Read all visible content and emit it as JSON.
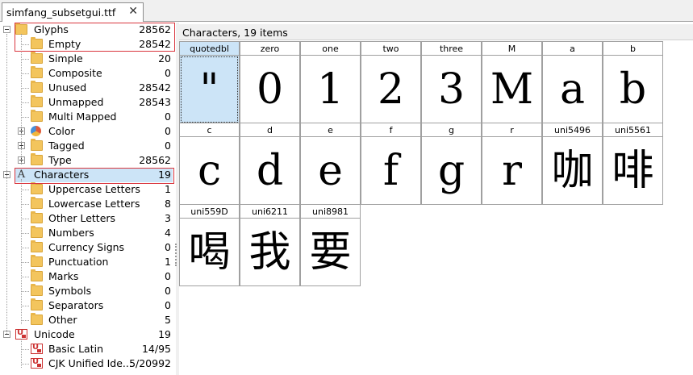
{
  "tab": {
    "title": "simfang_subsetgui.ttf",
    "close": "✕"
  },
  "tree": [
    {
      "name": "tree-item-glyphs",
      "label": "Glyphs",
      "count": "28562",
      "icon": "folder-icon",
      "expander": "minus"
    },
    {
      "name": "tree-item-empty",
      "label": "Empty",
      "count": "28542",
      "icon": "folder-icon"
    },
    {
      "name": "tree-item-simple",
      "label": "Simple",
      "count": "20",
      "icon": "folder-icon"
    },
    {
      "name": "tree-item-composite",
      "label": "Composite",
      "count": "0",
      "icon": "folder-icon"
    },
    {
      "name": "tree-item-unused",
      "label": "Unused",
      "count": "28542",
      "icon": "folder-icon"
    },
    {
      "name": "tree-item-unmapped",
      "label": "Unmapped",
      "count": "28543",
      "icon": "folder-icon"
    },
    {
      "name": "tree-item-multi-mapped",
      "label": "Multi Mapped",
      "count": "0",
      "icon": "folder-icon"
    },
    {
      "name": "tree-item-color",
      "label": "Color",
      "count": "0",
      "icon": "color-palette-icon",
      "expander": "plus"
    },
    {
      "name": "tree-item-tagged",
      "label": "Tagged",
      "count": "0",
      "icon": "folder-icon",
      "expander": "plus"
    },
    {
      "name": "tree-item-type",
      "label": "Type",
      "count": "28562",
      "icon": "folder-icon",
      "expander": "plus"
    },
    {
      "name": "tree-item-characters",
      "label": "Characters",
      "count": "19",
      "icon": "letter-a-icon",
      "glyph": "A",
      "expander": "minus"
    },
    {
      "name": "tree-item-uppercase-letters",
      "label": "Uppercase Letters",
      "count": "1",
      "icon": "folder-icon"
    },
    {
      "name": "tree-item-lowercase-letters",
      "label": "Lowercase Letters",
      "count": "8",
      "icon": "folder-icon"
    },
    {
      "name": "tree-item-other-letters",
      "label": "Other Letters",
      "count": "3",
      "icon": "folder-icon"
    },
    {
      "name": "tree-item-numbers",
      "label": "Numbers",
      "count": "4",
      "icon": "folder-icon"
    },
    {
      "name": "tree-item-currency-signs",
      "label": "Currency Signs",
      "count": "0",
      "icon": "folder-icon"
    },
    {
      "name": "tree-item-punctuation",
      "label": "Punctuation",
      "count": "1",
      "icon": "folder-icon"
    },
    {
      "name": "tree-item-marks",
      "label": "Marks",
      "count": "0",
      "icon": "folder-icon"
    },
    {
      "name": "tree-item-symbols",
      "label": "Symbols",
      "count": "0",
      "icon": "folder-icon"
    },
    {
      "name": "tree-item-separators",
      "label": "Separators",
      "count": "0",
      "icon": "folder-icon"
    },
    {
      "name": "tree-item-other",
      "label": "Other",
      "count": "5",
      "icon": "folder-icon"
    },
    {
      "name": "tree-item-unicode",
      "label": "Unicode",
      "count": "19",
      "icon": "unicode-icon",
      "expander": "minus"
    },
    {
      "name": "tree-item-basic-latin",
      "label": "Basic Latin",
      "count": "14/95",
      "icon": "unicode-icon"
    },
    {
      "name": "tree-item-cjk-unified",
      "label": "CJK Unified Ide...",
      "count": "5/20992",
      "icon": "unicode-icon"
    }
  ],
  "panel": {
    "header": "Characters, 19 items"
  },
  "characters": [
    {
      "name": "quotedbl",
      "glyph": "\""
    },
    {
      "name": "zero",
      "glyph": "0"
    },
    {
      "name": "one",
      "glyph": "1"
    },
    {
      "name": "two",
      "glyph": "2"
    },
    {
      "name": "three",
      "glyph": "3"
    },
    {
      "name": "M",
      "glyph": "M"
    },
    {
      "name": "a",
      "glyph": "a"
    },
    {
      "name": "b",
      "glyph": "b"
    },
    {
      "name": "c",
      "glyph": "c"
    },
    {
      "name": "d",
      "glyph": "d"
    },
    {
      "name": "e",
      "glyph": "e"
    },
    {
      "name": "f",
      "glyph": "f"
    },
    {
      "name": "g",
      "glyph": "g"
    },
    {
      "name": "r",
      "glyph": "r"
    },
    {
      "name": "uni5496",
      "glyph": "咖"
    },
    {
      "name": "uni5561",
      "glyph": "啡"
    },
    {
      "name": "uni559D",
      "glyph": "喝"
    },
    {
      "name": "uni6211",
      "glyph": "我"
    },
    {
      "name": "uni8981",
      "glyph": "要"
    }
  ],
  "selected_character": "quotedbl",
  "colors": {
    "selection": "#cce4f7",
    "highlight_box": "#d9363e",
    "folder": "#f3c55d"
  }
}
